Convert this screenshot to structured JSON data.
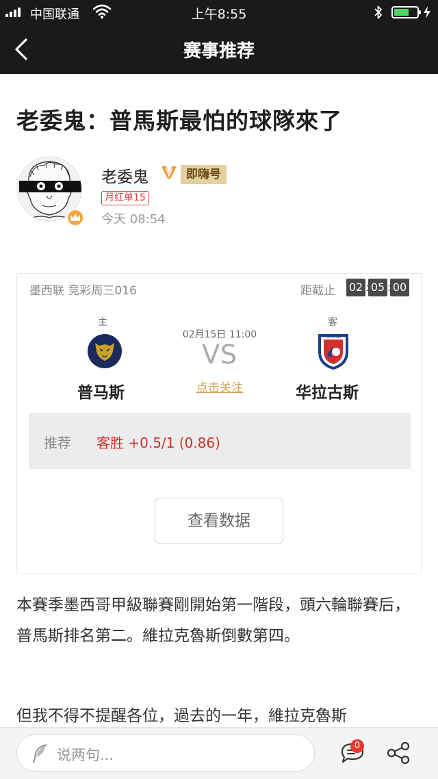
{
  "status_bar": {
    "carrier": "中国联通",
    "time": "上午8:55",
    "signal_bars": 4,
    "battery_level": 0.65,
    "battery_color": "#4cd964"
  },
  "nav": {
    "title": "赛事推荐",
    "back_icon": "chevron-left-icon"
  },
  "article": {
    "title": "老委鬼：普馬斯最怕的球隊來了",
    "author": {
      "name": "老委鬼",
      "tag": "即嗨号",
      "badge": "月红单15",
      "post_time": "今天 08:54",
      "verified_icon": "v-badge-icon",
      "crown_icon": "crown-icon"
    }
  },
  "match": {
    "league": "墨西联  竞彩周三016",
    "deadline_label": "距截止",
    "countdown": [
      "02",
      "05",
      "00"
    ],
    "home": {
      "label": "主",
      "name": "普马斯",
      "logo_icon": "pumas-logo-icon"
    },
    "away": {
      "label": "客",
      "name": "华拉古斯",
      "logo_icon": "veracruz-logo-icon"
    },
    "kickoff": "02月15日 11:00",
    "vs": "VS",
    "follow_label": "点击关注",
    "recommendation": {
      "label": "推荐",
      "value": "客胜 +0.5/1 (0.86)"
    },
    "data_button": "查看数据"
  },
  "body": {
    "paragraphs": [
      "本賽季墨西哥甲級聯賽剛開始第一階段，頭六輪聯賽后，普馬斯排名第二。維拉克魯斯倒數第四。",
      "但我不得不提醒各位，過去的一年，維拉克魯斯"
    ]
  },
  "comment_bar": {
    "placeholder": "说两句...",
    "comment_count": "0",
    "icons": [
      "feather-icon",
      "comment-icon",
      "share-icon"
    ]
  },
  "colors": {
    "header_bg": "#1a1a1a",
    "accent_red": "#d0312d",
    "follow_gold": "#d4a24c",
    "tag_bg": "#e3d0a0"
  }
}
